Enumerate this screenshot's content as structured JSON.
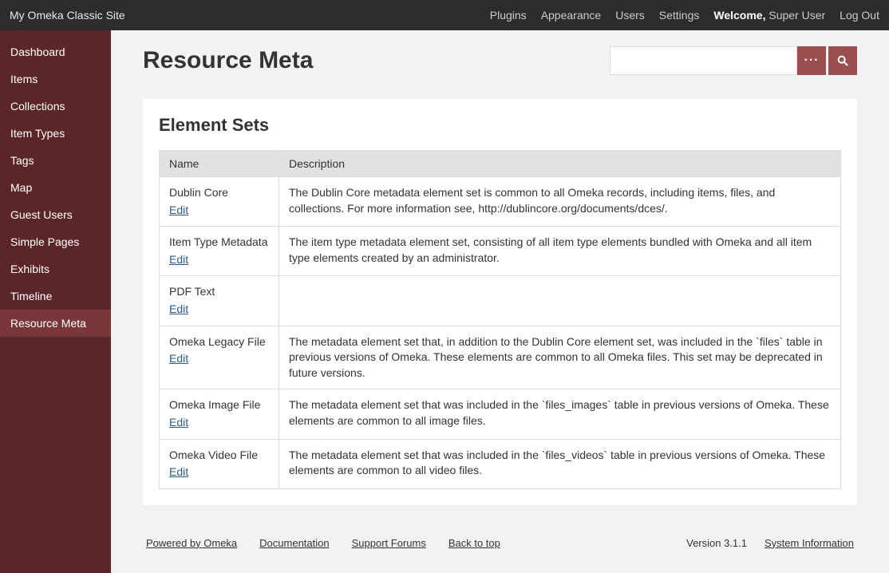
{
  "top": {
    "site_title": "My Omeka Classic Site",
    "links": {
      "plugins": "Plugins",
      "appearance": "Appearance",
      "users": "Users",
      "settings": "Settings"
    },
    "welcome_label": "Welcome,",
    "welcome_user": "Super User",
    "logout": "Log Out"
  },
  "sidebar": {
    "items": [
      {
        "label": "Dashboard"
      },
      {
        "label": "Items"
      },
      {
        "label": "Collections"
      },
      {
        "label": "Item Types"
      },
      {
        "label": "Tags"
      },
      {
        "label": "Map"
      },
      {
        "label": "Guest Users"
      },
      {
        "label": "Simple Pages"
      },
      {
        "label": "Exhibits"
      },
      {
        "label": "Timeline"
      },
      {
        "label": "Resource Meta"
      }
    ]
  },
  "page": {
    "title": "Resource Meta",
    "section_title": "Element Sets"
  },
  "search": {
    "adv_label": "···"
  },
  "table": {
    "headers": {
      "name": "Name",
      "description": "Description"
    },
    "edit_label": "Edit",
    "rows": [
      {
        "name": "Dublin Core",
        "desc": "The Dublin Core metadata element set is common to all Omeka records, including items, files, and collections. For more information see, http://dublincore.org/documents/dces/."
      },
      {
        "name": "Item Type Metadata",
        "desc": "The item type metadata element set, consisting of all item type elements bundled with Omeka and all item type elements created by an administrator."
      },
      {
        "name": "PDF Text",
        "desc": ""
      },
      {
        "name": "Omeka Legacy File",
        "desc": "The metadata element set that, in addition to the Dublin Core element set, was included in the `files` table in previous versions of Omeka. These elements are common to all Omeka files. This set may be deprecated in future versions."
      },
      {
        "name": "Omeka Image File",
        "desc": "The metadata element set that was included in the `files_images` table in previous versions of Omeka. These elements are common to all image files."
      },
      {
        "name": "Omeka Video File",
        "desc": "The metadata element set that was included in the `files_videos` table in previous versions of Omeka. These elements are common to all video files."
      }
    ]
  },
  "footer": {
    "powered": "Powered by Omeka",
    "documentation": "Documentation",
    "forums": "Support Forums",
    "backtotop": "Back to top",
    "version": "Version 3.1.1",
    "sysinfo": "System Information"
  }
}
